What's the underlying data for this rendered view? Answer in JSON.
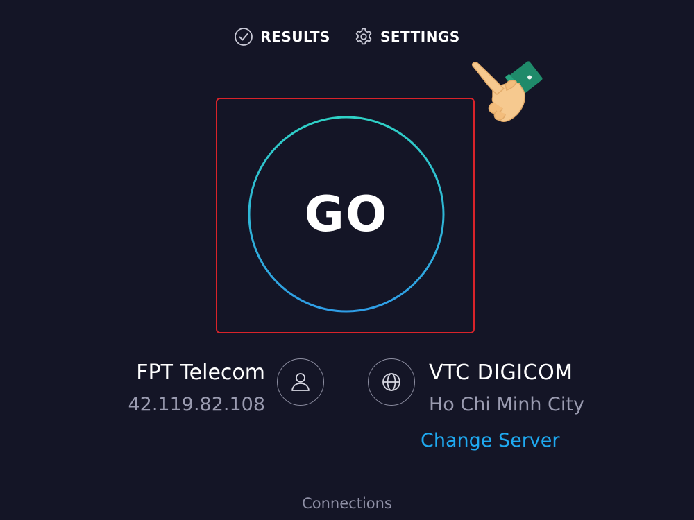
{
  "nav": {
    "results_label": "RESULTS",
    "settings_label": "SETTINGS",
    "results_icon": "check-circle-icon",
    "settings_icon": "gear-icon"
  },
  "go_button": {
    "label": "GO"
  },
  "provider": {
    "isp_name": "FPT Telecom",
    "ip_address": "42.119.82.108",
    "icon": "user-icon"
  },
  "server": {
    "name": "VTC DIGICOM",
    "location": "Ho Chi Minh City",
    "change_label": "Change Server",
    "icon": "globe-icon"
  },
  "footer": {
    "connections_label": "Connections"
  },
  "colors": {
    "background": "#141526",
    "highlight_border": "#d8232a",
    "ring_gradient_top": "#2fd1c6",
    "ring_gradient_bottom": "#2f9de6",
    "link": "#1fa9f0",
    "muted_text": "#9a9bb0"
  }
}
